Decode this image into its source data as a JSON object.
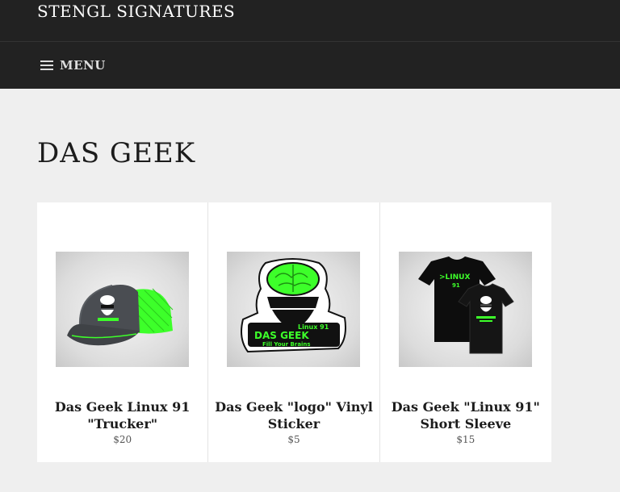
{
  "header": {
    "site_title": "STENGL SIGNATURES",
    "menu_label": "MENU"
  },
  "collection": {
    "title": "DAS GEEK"
  },
  "products": [
    {
      "title": "Das Geek Linux 91 \"Trucker\"",
      "price": "$20",
      "image": "trucker-cap-image"
    },
    {
      "title": "Das Geek \"logo\" Vinyl Sticker",
      "price": "$5",
      "image": "vinyl-sticker-image"
    },
    {
      "title": "Das Geek \"Linux 91\" Short Sleeve",
      "price": "$15",
      "image": "tshirt-image"
    }
  ],
  "product_graphics": {
    "sticker_line1": "Linux 91",
    "sticker_line2": "DAS GEEK",
    "sticker_line3": "Fill Your Brains",
    "shirt_text": ">LINUX",
    "shirt_number": "91"
  },
  "colors": {
    "header_bg": "#222222",
    "page_bg": "#efefef",
    "accent_green": "#39ff14",
    "card_bg": "#ffffff"
  }
}
